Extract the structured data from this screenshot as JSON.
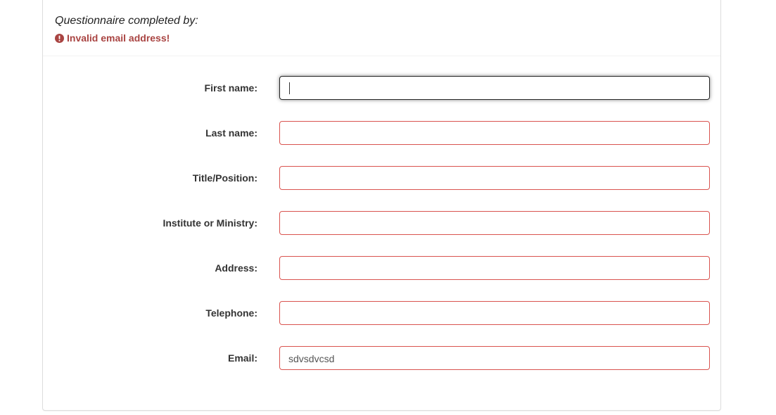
{
  "panel": {
    "title": "Questionnaire completed by:",
    "error": {
      "icon": "exclamation-circle-icon",
      "text": "Invalid email address!",
      "color": "#a94442"
    }
  },
  "form": {
    "invalid_border_color": "#d9534f",
    "fields": [
      {
        "label": "First name:",
        "value": "",
        "focused": true
      },
      {
        "label": "Last name:",
        "value": ""
      },
      {
        "label": "Title/Position:",
        "value": ""
      },
      {
        "label": "Institute or Ministry:",
        "value": ""
      },
      {
        "label": "Address:",
        "value": ""
      },
      {
        "label": "Telephone:",
        "value": ""
      },
      {
        "label": "Email:",
        "value": "sdvsdvcsd"
      }
    ]
  }
}
